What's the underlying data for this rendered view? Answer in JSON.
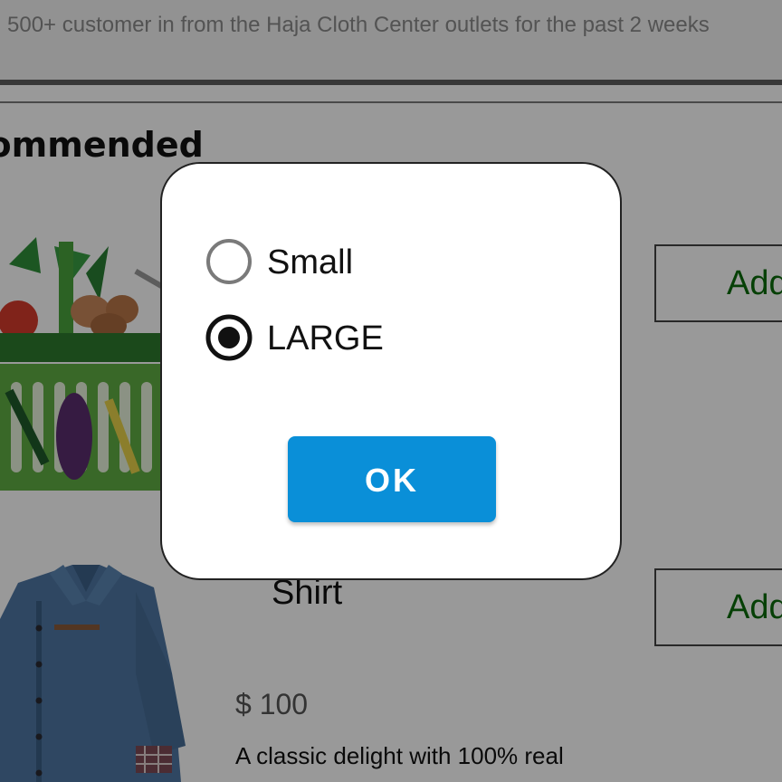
{
  "banner": {
    "text": "500+ customer in from the Haja Cloth Center outlets for the past 2 weeks"
  },
  "section": {
    "title": "commended"
  },
  "products": [
    {
      "image_icon": "vegetable-basket-image",
      "add_label": "Add"
    },
    {
      "image_icon": "denim-shirt-image",
      "name": "Shirt",
      "price": "$ 100",
      "description": "A classic delight with 100% real",
      "add_label": "Add"
    }
  ],
  "dialog": {
    "options": [
      {
        "label": "Small",
        "selected": false
      },
      {
        "label": "LARGE",
        "selected": true
      }
    ],
    "ok_label": "OK"
  },
  "colors": {
    "accent": "#0a8fd8",
    "add_text": "#0a6b0a",
    "radio_selected": "#111111",
    "radio_unselected": "#7a7a7a"
  }
}
